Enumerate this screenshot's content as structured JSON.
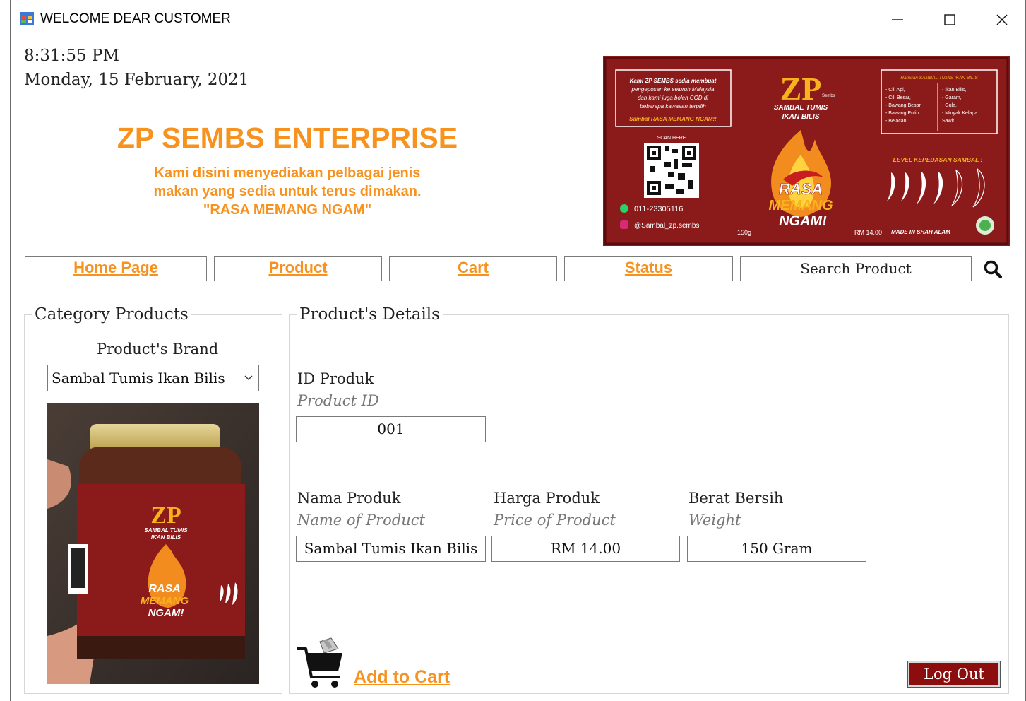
{
  "window": {
    "title": "WELCOME DEAR CUSTOMER"
  },
  "clock": {
    "time": "8:31:55 PM",
    "date": "Monday, 15 February, 2021"
  },
  "brand": {
    "name": "ZP SEMBS ENTERPRISE",
    "tagline_1": "Kami disini menyediakan pelbagai jenis",
    "tagline_2": "makan yang sedia untuk terus dimakan.",
    "tagline_3": "\"RASA MEMANG NGAM\""
  },
  "banner": {
    "intro_1": "Kami ZP SEMBS sedia membuat",
    "intro_2": "pengeposan ke seluruh Malaysia",
    "intro_3": "dan kami juga boleh COD di",
    "intro_4": "beberapa kawasan terpilih",
    "intro_5": "Sambal RASA MEMANG NGAM!!",
    "logo": "ZP",
    "logo_sub": "Sembs",
    "product_1": "SAMBAL TUMIS",
    "product_2": "IKAN BILIS",
    "scan": "SCAN HERE",
    "slogan_1": "RASA",
    "slogan_2": "MEMANG",
    "slogan_3": "NGAM!",
    "phone": "011-23305116",
    "instagram": "@Sambal_zp.sembs",
    "weight": "150g",
    "price": "RM 14.00",
    "made_in": "MADE IN SHAH ALAM",
    "ingredients_title": "Ramuan SAMBAL TUMIS IKAN BILIS",
    "ingredients_left": [
      "- Cili Api,",
      "- Cili Besar,",
      "- Bawang Besar",
      "- Bawang Putih",
      "- Belacan,"
    ],
    "ingredients_right": [
      "- Ikan Bilis,",
      "- Garam,",
      "- Gula,",
      "- Minyak Kelapa",
      "  Sawit"
    ],
    "spice_level": "LEVEL KEPEDASAN SAMBAL :"
  },
  "nav": {
    "home": "Home Page",
    "product": "Product",
    "cart": "Cart",
    "status": "Status",
    "search_placeholder": "Search Product"
  },
  "category": {
    "legend": "Category Products",
    "brand_label": "Product's Brand",
    "brand_selected": "Sambal Tumis Ikan Bilis"
  },
  "details": {
    "legend": "Product's Details",
    "id_label": "ID Produk",
    "id_sub": "Product ID",
    "id_value": "001",
    "name_label": "Nama Produk",
    "name_sub": "Name of Product",
    "name_value": "Sambal Tumis Ikan Bilis",
    "price_label": "Harga Produk",
    "price_sub": "Price of Product",
    "price_value": "RM 14.00",
    "weight_label": "Berat Bersih",
    "weight_sub": "Weight",
    "weight_value": "150 Gram"
  },
  "actions": {
    "add_to_cart": "Add to Cart",
    "logout": "Log Out"
  },
  "colors": {
    "accent": "#f7921e",
    "maroon": "#8b0d0d"
  }
}
